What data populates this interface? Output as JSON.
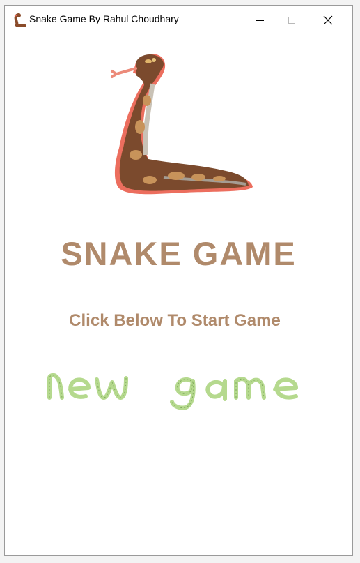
{
  "window": {
    "title": "Snake Game By Rahul Choudhary",
    "app_icon": "snake-icon",
    "controls": [
      "minimize-icon",
      "maximize-icon",
      "close-icon"
    ]
  },
  "menu": {
    "title": "SNAKE GAME",
    "subtitle": "Click Below To Start Game",
    "logo_image": "snake-illustration",
    "start_button_text": "new game"
  },
  "colors": {
    "title": "#b08a6b",
    "snake_body": "#7b4a2d",
    "snake_outline": "#e8695b",
    "button_stroke": "#b5d98e"
  }
}
